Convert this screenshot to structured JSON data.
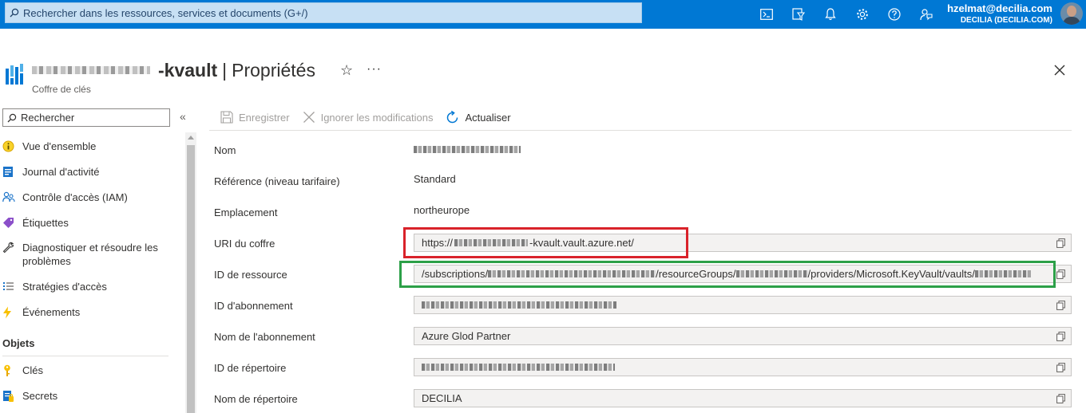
{
  "topbar": {
    "search_placeholder": "Rechercher dans les ressources, services et documents (G+/)",
    "icons": [
      "cloud-shell-icon",
      "directory-filter-icon",
      "notifications-icon",
      "settings-icon",
      "help-icon",
      "feedback-icon"
    ],
    "user_email": "hzelmat@decilia.com",
    "user_tenant": "DECILIA (DECILIA.COM)",
    "color": "#0078d4"
  },
  "header": {
    "resource_name_suffix": "-kvault",
    "separator": "|",
    "page": "Propriétés",
    "subtitle": "Coffre de clés",
    "star": "☆",
    "more": "···"
  },
  "sidebar": {
    "search_placeholder": "Rechercher",
    "collapse": "«",
    "items": [
      {
        "label": "Vue d'ensemble",
        "icon": "overview-icon"
      },
      {
        "label": "Journal d'activité",
        "icon": "activity-log-icon"
      },
      {
        "label": "Contrôle d'accès (IAM)",
        "icon": "iam-icon"
      },
      {
        "label": "Étiquettes",
        "icon": "tag-icon"
      },
      {
        "label": "Diagnostiquer et résoudre les problèmes",
        "icon": "wrench-icon"
      },
      {
        "label": "Stratégies d'accès",
        "icon": "access-policies-icon"
      },
      {
        "label": "Événements",
        "icon": "events-icon"
      }
    ],
    "section": "Objets",
    "section_items": [
      {
        "label": "Clés",
        "icon": "key-icon"
      },
      {
        "label": "Secrets",
        "icon": "secrets-icon"
      }
    ]
  },
  "toolbar": {
    "save": "Enregistrer",
    "discard": "Ignorer les modifications",
    "refresh": "Actualiser"
  },
  "properties": {
    "name_label": "Nom",
    "sku_label": "Référence (niveau tarifaire)",
    "sku_value": "Standard",
    "location_label": "Emplacement",
    "location_value": "northeurope",
    "uri_label": "URI du coffre",
    "uri_prefix": "https://",
    "uri_suffix": "-kvault.vault.azure.net/",
    "resource_id_label": "ID de ressource",
    "resource_id_part1": "/subscriptions/",
    "resource_id_part2": "/resourceGroups/",
    "resource_id_part3": "/providers/Microsoft.KeyVault/vaults/",
    "subscription_id_label": "ID d'abonnement",
    "subscription_name_label": "Nom de l'abonnement",
    "subscription_name_value": "Azure Glod Partner",
    "directory_id_label": "ID de répertoire",
    "directory_name_label": "Nom de répertoire",
    "directory_name_value": "DECILIA"
  }
}
